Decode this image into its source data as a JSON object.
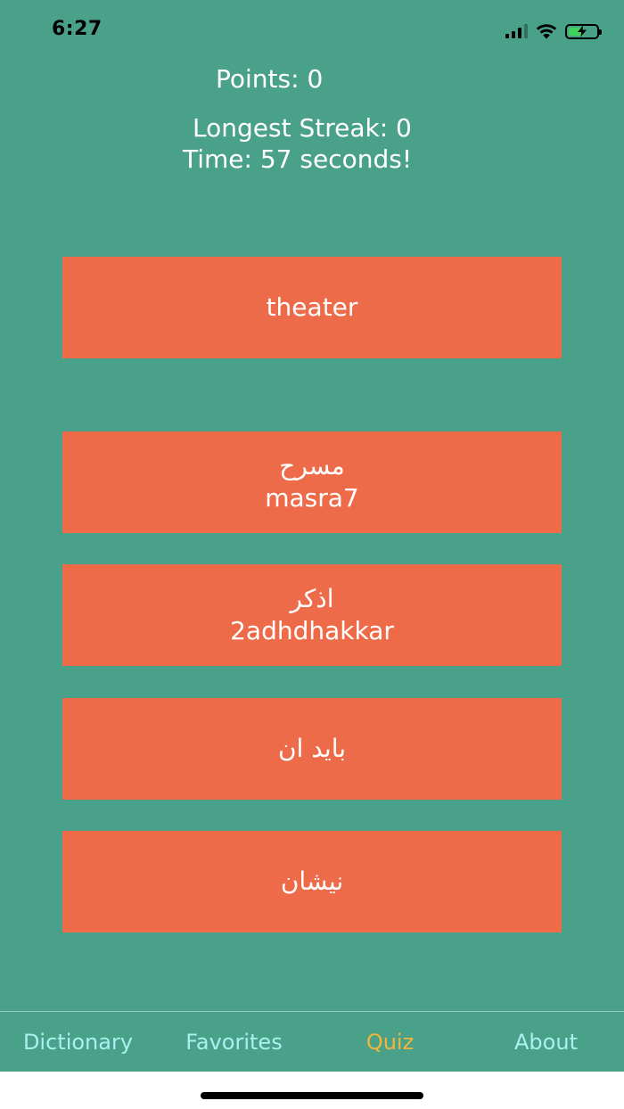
{
  "status_bar": {
    "time": "6:27",
    "signal_icon": "cellular-signal-icon",
    "wifi_icon": "wifi-icon",
    "battery_icon": "battery-charging-icon",
    "battery_level": 0.55
  },
  "quiz": {
    "points": "Points: 0",
    "longest_streak": "Longest Streak: 0",
    "time": "Time: 57 seconds!",
    "prompt": "theater",
    "options": [
      {
        "arabic": "مسرح",
        "transliteration": "masra7"
      },
      {
        "arabic": "اذكر",
        "transliteration": "2adhdhakkar"
      },
      {
        "arabic": "بايد ان",
        "transliteration": ""
      },
      {
        "arabic": "نيشان",
        "transliteration": ""
      }
    ]
  },
  "tabbar": {
    "tabs": [
      {
        "label": "Dictionary"
      },
      {
        "label": "Favorites"
      },
      {
        "label": "Quiz"
      },
      {
        "label": "About"
      }
    ],
    "active": "Quiz"
  },
  "colors": {
    "background": "#4aa189",
    "button": "#ee6b49",
    "tab_inactive": "#a9f0ef",
    "tab_active": "#f3b43a"
  }
}
